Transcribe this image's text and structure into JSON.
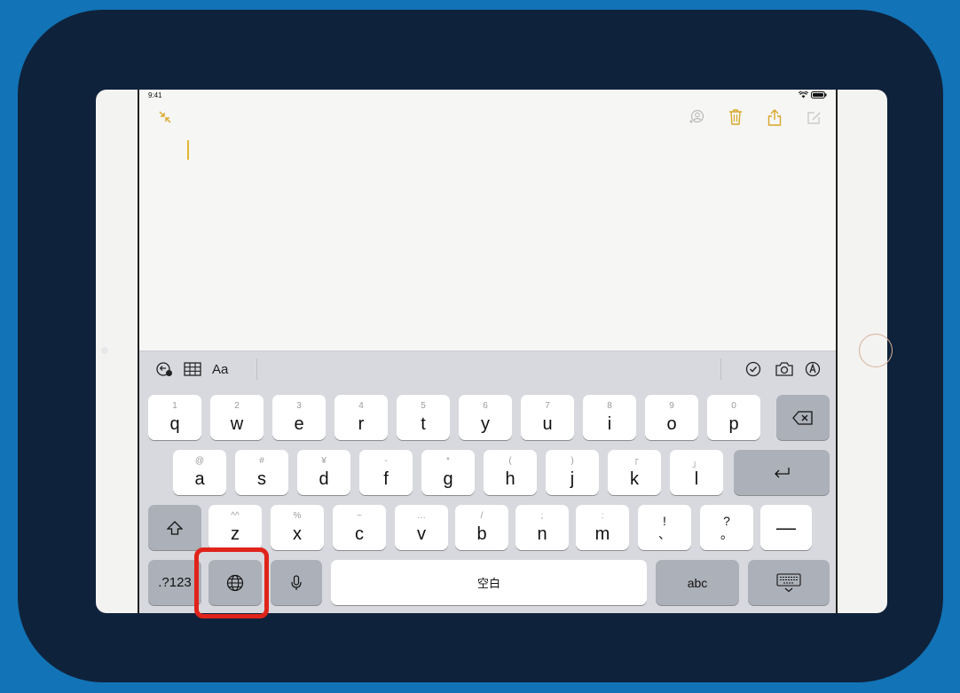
{
  "colors": {
    "background": "#1273b6",
    "panel": "#0f223b",
    "accent_yellow": "#e3b72f",
    "highlight_red": "#e0241b"
  },
  "status_bar": {
    "time": "9:41",
    "icons": [
      "wifi-icon",
      "battery-icon"
    ]
  },
  "notes": {
    "toolbar_icons": [
      "collapse-icon",
      "share-person-icon",
      "trash-icon",
      "share-icon",
      "compose-icon"
    ],
    "content": ""
  },
  "keyboard": {
    "assist_bar": {
      "left": [
        "undo-redo-icon",
        "table-icon"
      ],
      "format_label": "Aa",
      "right": [
        "checklist-icon",
        "camera-icon",
        "markup-icon"
      ]
    },
    "row1": [
      {
        "key": "q",
        "hint": "1"
      },
      {
        "key": "w",
        "hint": "2"
      },
      {
        "key": "e",
        "hint": "3"
      },
      {
        "key": "r",
        "hint": "4"
      },
      {
        "key": "t",
        "hint": "5"
      },
      {
        "key": "y",
        "hint": "6"
      },
      {
        "key": "u",
        "hint": "7"
      },
      {
        "key": "i",
        "hint": "8"
      },
      {
        "key": "o",
        "hint": "9"
      },
      {
        "key": "p",
        "hint": "0"
      }
    ],
    "row2": [
      {
        "key": "a",
        "hint": "@"
      },
      {
        "key": "s",
        "hint": "#"
      },
      {
        "key": "d",
        "hint": "¥"
      },
      {
        "key": "f",
        "hint": "-"
      },
      {
        "key": "g",
        "hint": "*"
      },
      {
        "key": "h",
        "hint": "("
      },
      {
        "key": "j",
        "hint": ")"
      },
      {
        "key": "k",
        "hint": "「"
      },
      {
        "key": "l",
        "hint": "」"
      }
    ],
    "row3": [
      {
        "key": "z",
        "hint": "^^"
      },
      {
        "key": "x",
        "hint": "%"
      },
      {
        "key": "c",
        "hint": "~"
      },
      {
        "key": "v",
        "hint": "…"
      },
      {
        "key": "b",
        "hint": "/"
      },
      {
        "key": "n",
        "hint": ";"
      },
      {
        "key": "m",
        "hint": ":"
      }
    ],
    "row3_punct": [
      {
        "top": "!",
        "bottom": "、"
      },
      {
        "top": "?",
        "bottom": "。"
      }
    ],
    "dash_key": "—",
    "numbers_key": ".?123",
    "space_key": "空白",
    "abc_key": "abc"
  }
}
